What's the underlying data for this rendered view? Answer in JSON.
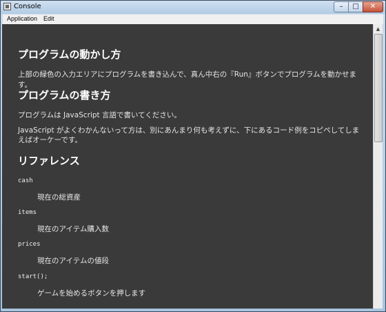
{
  "window": {
    "title": "Console"
  },
  "controls": {
    "minimize": "–",
    "maximize": "□",
    "close": "✕"
  },
  "menu": {
    "items": [
      "Application",
      "Edit"
    ]
  },
  "sections": {
    "s1": {
      "heading": "プログラムの動かし方",
      "text": "上部の緑色の入力エリアにプログラムを書き込んで、真ん中右の『Run』ボタンでプログラムを動かせます。"
    },
    "s2": {
      "heading": "プログラムの書き方",
      "text1": "プログラムは JavaScript 言語で書いてください。",
      "text2": "JavaScript がよくわかんないって方は、別にあんまり何も考えずに、下にあるコード例をコピペしてしまえばオーケーです。"
    },
    "s3": {
      "heading": "リファレンス",
      "entries": [
        {
          "code": "cash",
          "desc": "現在の総資産"
        },
        {
          "code": "items",
          "desc": "現在のアイテム購入数"
        },
        {
          "code": "prices",
          "desc": "現在のアイテムの値段"
        },
        {
          "code": "start();",
          "desc": "ゲームを始めるボタンを押します"
        }
      ]
    }
  }
}
